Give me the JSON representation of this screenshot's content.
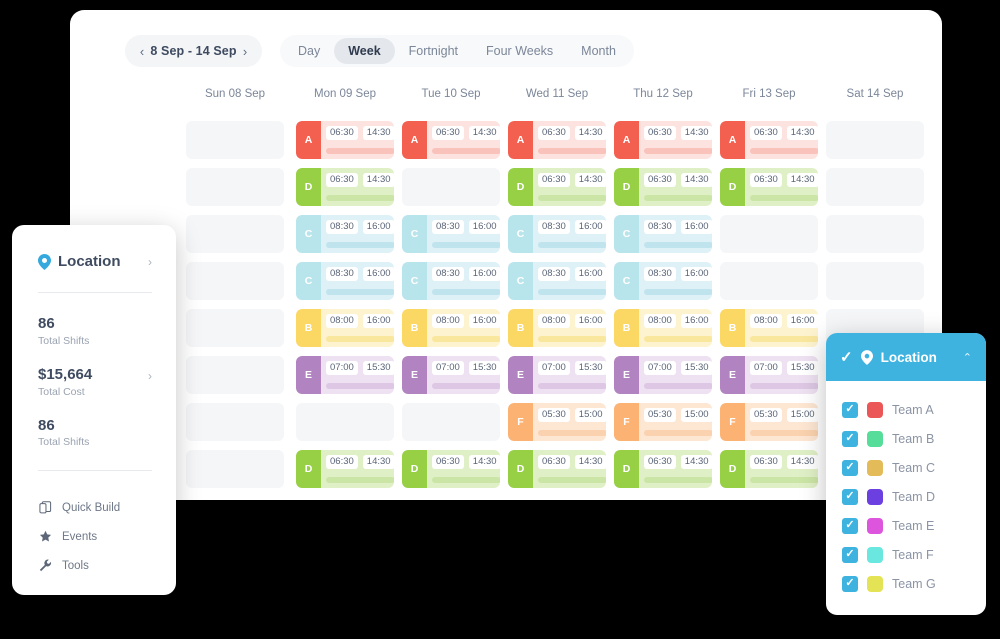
{
  "toolbar": {
    "prev_label": "‹",
    "next_label": "›",
    "date_range": "8 Sep - 14 Sep",
    "views": [
      {
        "label": "Day",
        "active": false
      },
      {
        "label": "Week",
        "active": true
      },
      {
        "label": "Fortnight",
        "active": false
      },
      {
        "label": "Four Weeks",
        "active": false
      },
      {
        "label": "Month",
        "active": false
      }
    ]
  },
  "calendar": {
    "days": [
      "Sun 08 Sep",
      "Mon 09 Sep",
      "Tue 10 Sep",
      "Wed 11 Sep",
      "Thu 12 Sep",
      "Fri 13 Sep",
      "Sat 14 Sep"
    ],
    "row_label_placeholders": 3,
    "teams": {
      "A": {
        "tag": "A",
        "tag_color": "#f4604f",
        "bg_color": "#fde3df",
        "bar_color": "#f9c3bb"
      },
      "B": {
        "tag": "B",
        "tag_color": "#fbd764",
        "bg_color": "#fdf3cf",
        "bar_color": "#fae79e"
      },
      "C": {
        "tag": "C",
        "tag_color": "#b8e4ec",
        "bg_color": "#ddf1f6",
        "bar_color": "#bfe4ee"
      },
      "D": {
        "tag": "D",
        "tag_color": "#97cf45",
        "bg_color": "#e0f0c6",
        "bar_color": "#cbe5a6"
      },
      "E": {
        "tag": "E",
        "tag_color": "#b183c0",
        "bg_color": "#eee1f1",
        "bar_color": "#ddc7e4"
      },
      "F": {
        "tag": "F",
        "tag_color": "#fbb273",
        "bg_color": "#fde6d2",
        "bar_color": "#fad2af"
      }
    },
    "rows": [
      {
        "team": "D",
        "start": "06:30",
        "end": "14:30",
        "cells": [
          null,
          "A",
          "A",
          "A",
          "A",
          "A",
          null
        ],
        "overrides": {
          "team": "A",
          "start": "06:30",
          "end": "14:30"
        }
      },
      {
        "team": "D",
        "start": "06:30",
        "end": "14:30",
        "cells": [
          null,
          "D",
          null,
          "D",
          "D",
          "D",
          null
        ]
      },
      {
        "team": "C",
        "start": "08:30",
        "end": "16:00",
        "cells": [
          null,
          "C",
          "C",
          "C",
          "C",
          null,
          null
        ]
      },
      {
        "team": "C",
        "start": "08:30",
        "end": "16:00",
        "cells": [
          null,
          "C",
          "C",
          "C",
          "C",
          null,
          null
        ]
      },
      {
        "team": "B",
        "start": "08:00",
        "end": "16:00",
        "cells": [
          null,
          "B",
          "B",
          "B",
          "B",
          "B",
          null
        ]
      },
      {
        "team": "E",
        "start": "07:00",
        "end": "15:30",
        "cells": [
          null,
          "E",
          "E",
          "E",
          "E",
          "E",
          null
        ]
      },
      {
        "team": "F",
        "start": "05:30",
        "end": "15:00",
        "cells": [
          null,
          null,
          null,
          "F",
          "F",
          "F",
          null
        ]
      },
      {
        "team": "D",
        "start": "06:30",
        "end": "14:30",
        "cells": [
          null,
          "D",
          "D",
          "D",
          "D",
          "D",
          null
        ]
      }
    ]
  },
  "stats_card": {
    "header_title": "Location",
    "header_chevron": "›",
    "stats": [
      {
        "value": "86",
        "label": "Total Shifts",
        "chevron": ""
      },
      {
        "value": "$15,664",
        "label": "Total Cost",
        "chevron": "›"
      },
      {
        "value": "86",
        "label": "Total Shifts",
        "chevron": ""
      }
    ],
    "nav_items": [
      {
        "label": "Quick Build",
        "icon": "copy-icon"
      },
      {
        "label": "Events",
        "icon": "star-icon"
      },
      {
        "label": "Tools",
        "icon": "wrench-icon"
      }
    ]
  },
  "location_panel": {
    "header_title": "Location",
    "header_tick": "✓",
    "header_caret": "⌃",
    "accent_color": "#3fb3e0",
    "teams": [
      {
        "label": "Team A",
        "color": "#eb5757",
        "checked": true
      },
      {
        "label": "Team B",
        "color": "#55dd99",
        "checked": true
      },
      {
        "label": "Team C",
        "color": "#e4bb59",
        "checked": true
      },
      {
        "label": "Team D",
        "color": "#6b3fe0",
        "checked": true
      },
      {
        "label": "Team E",
        "color": "#dd55dd",
        "checked": true
      },
      {
        "label": "Team F",
        "color": "#6ae8e0",
        "checked": true
      },
      {
        "label": "Team G",
        "color": "#e3e355",
        "checked": true
      }
    ]
  }
}
